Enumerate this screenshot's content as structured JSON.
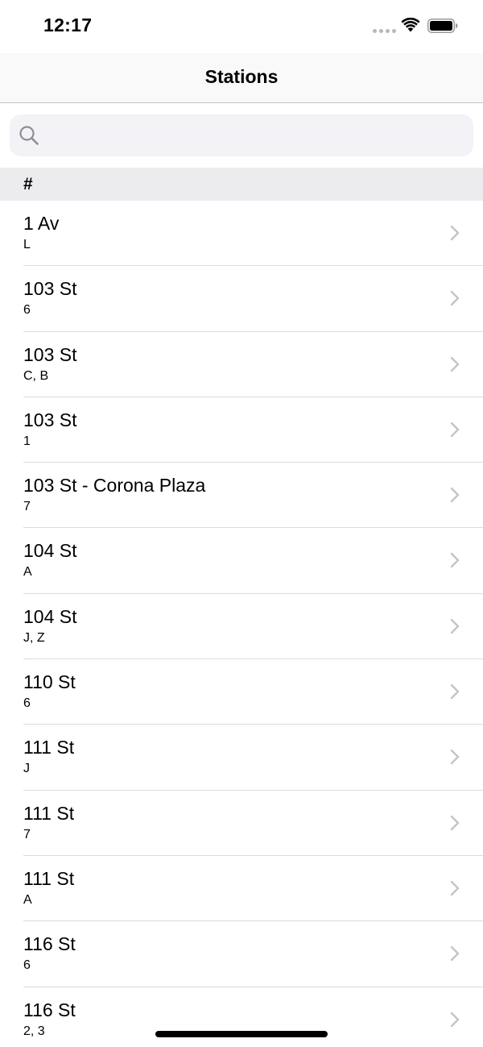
{
  "status_bar": {
    "time": "12:17",
    "signal_icon": "cellular-dots-icon",
    "wifi_icon": "wifi-icon",
    "battery_icon": "battery-icon"
  },
  "nav": {
    "title": "Stations"
  },
  "search": {
    "placeholder": "",
    "value": "",
    "icon": "search-icon"
  },
  "section": {
    "header": "#"
  },
  "stations": [
    {
      "name": "1 Av",
      "lines": "L"
    },
    {
      "name": "103 St",
      "lines": "6"
    },
    {
      "name": "103 St",
      "lines": "C, B"
    },
    {
      "name": "103 St",
      "lines": "1"
    },
    {
      "name": "103 St - Corona Plaza",
      "lines": "7"
    },
    {
      "name": "104 St",
      "lines": "A"
    },
    {
      "name": "104 St",
      "lines": "J, Z"
    },
    {
      "name": "110 St",
      "lines": "6"
    },
    {
      "name": "111 St",
      "lines": "J"
    },
    {
      "name": "111 St",
      "lines": "7"
    },
    {
      "name": "111 St",
      "lines": "A"
    },
    {
      "name": "116 St",
      "lines": "6"
    },
    {
      "name": "116 St",
      "lines": "2, 3"
    }
  ],
  "colors": {
    "nav_background": "#f9f9f9",
    "search_background": "#f2f2f7",
    "section_background": "#ececef",
    "chevron": "#c4c4c7",
    "separator": "#dcdcde"
  }
}
